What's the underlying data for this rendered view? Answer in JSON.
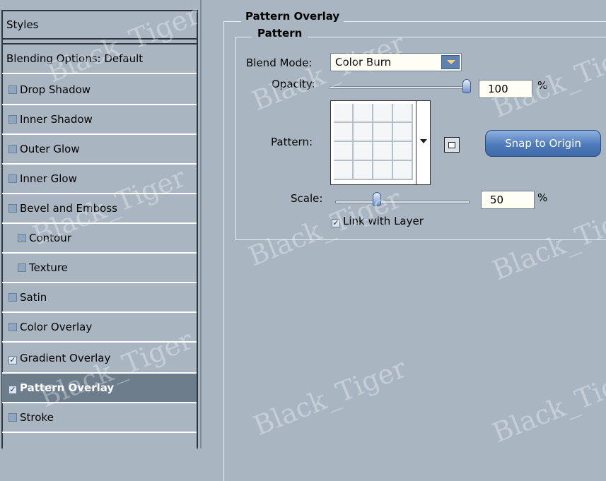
{
  "sidebar": {
    "header": "Styles",
    "blending_options": "Blending Options: Default",
    "items": [
      {
        "label": "Drop Shadow",
        "checked": false
      },
      {
        "label": "Inner Shadow",
        "checked": false
      },
      {
        "label": "Outer Glow",
        "checked": false
      },
      {
        "label": "Inner Glow",
        "checked": false
      },
      {
        "label": "Bevel and Emboss",
        "checked": false
      },
      {
        "label": "Contour",
        "checked": false
      },
      {
        "label": "Texture",
        "checked": false
      },
      {
        "label": "Satin",
        "checked": false
      },
      {
        "label": "Color Overlay",
        "checked": false
      },
      {
        "label": "Gradient Overlay",
        "checked": true
      },
      {
        "label": "Pattern Overlay",
        "checked": true,
        "selected": true
      },
      {
        "label": "Stroke",
        "checked": false
      }
    ]
  },
  "panel": {
    "title": "Pattern Overlay",
    "group_title": "Pattern",
    "blend_mode": {
      "label": "Blend Mode:",
      "value": "Color Burn"
    },
    "opacity": {
      "label": "Opacity:",
      "value": "100",
      "unit": "%",
      "fraction": 1.0
    },
    "pattern": {
      "label": "Pattern:"
    },
    "snap_button": "Snap to Origin",
    "scale": {
      "label": "Scale:",
      "value": "50",
      "unit": "%",
      "fraction": 0.3
    },
    "link_with_layer": {
      "label": "Link with Layer",
      "checked": true
    }
  },
  "watermark": "Black_Tiger",
  "colors": {
    "background": "#a9b6c2",
    "selected_row": "#6d7d8c",
    "button_blue": "#4f7bbb"
  }
}
